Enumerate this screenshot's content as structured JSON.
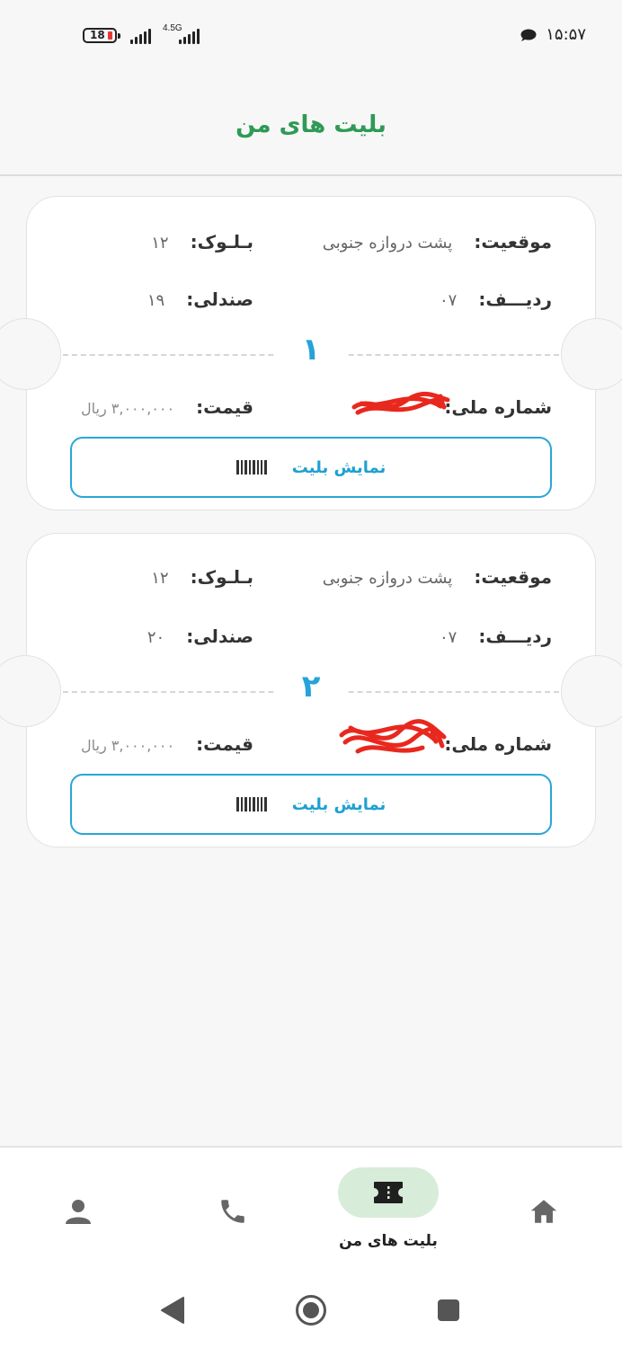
{
  "status_bar": {
    "battery": "18",
    "network": "4.5G",
    "time": "۱۵:۵۷"
  },
  "header": {
    "title": "بلیت های من"
  },
  "labels": {
    "location": "موقعیت:",
    "block": "بـلـوک:",
    "row": "ردیـــف:",
    "seat": "صندلی:",
    "national_id": "شماره ملی:",
    "price": "قیمت:",
    "show_ticket": "نمایش بلیت"
  },
  "tickets": [
    {
      "number": "۱",
      "location": "پشت دروازه جنوبی",
      "block": "۱۲",
      "row": "۰۷",
      "seat": "۱۹",
      "price": "۳,۰۰۰,۰۰۰  ریال"
    },
    {
      "number": "۲",
      "location": "پشت دروازه جنوبی",
      "block": "۱۲",
      "row": "۰۷",
      "seat": "۲۰",
      "price": "۳,۰۰۰,۰۰۰  ریال"
    }
  ],
  "bottom_nav": {
    "active_label": "بلیت های من",
    "items": [
      "home-icon",
      "ticket-icon",
      "phone-icon",
      "profile-icon"
    ]
  },
  "colors": {
    "title_green": "#2e9a55",
    "accent_blue": "#2aa6d6",
    "active_pill": "#d7ecd9",
    "redaction": "#e8281e"
  }
}
